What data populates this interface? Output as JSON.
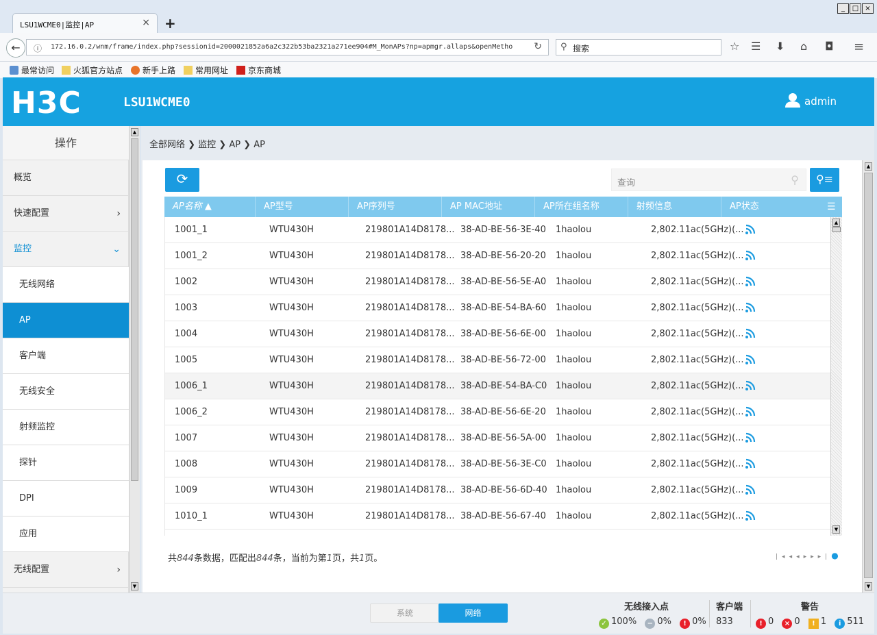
{
  "browser": {
    "tab_title": "LSU1WCME0|监控|AP",
    "tab_close": "×",
    "new_tab": "+",
    "url": "172.16.0.2/wnm/frame/index.php?sessionid=2000021852a6a2c322b53ba2321a271ee904#M_MonAPs?np=apmgr.allaps&openMetho",
    "search_placeholder": "搜索",
    "bookmarks": [
      "最常访问",
      "火狐官方站点",
      "新手上路",
      "常用网址",
      "京东商城"
    ],
    "window_controls": [
      "_",
      "□",
      "×"
    ]
  },
  "header": {
    "logo": "H3C",
    "device_name": "LSU1WCME0",
    "user": "admin"
  },
  "sidebar": {
    "title": "操作",
    "items": [
      {
        "label": "概览",
        "chevron": ""
      },
      {
        "label": "快速配置",
        "chevron": "›"
      },
      {
        "label": "监控",
        "chevron": "⌄"
      },
      {
        "label": "无线网络",
        "chevron": ""
      },
      {
        "label": "AP",
        "chevron": ""
      },
      {
        "label": "客户端",
        "chevron": ""
      },
      {
        "label": "无线安全",
        "chevron": ""
      },
      {
        "label": "射频监控",
        "chevron": ""
      },
      {
        "label": "探针",
        "chevron": ""
      },
      {
        "label": "DPI",
        "chevron": ""
      },
      {
        "label": "应用",
        "chevron": ""
      },
      {
        "label": "无线配置",
        "chevron": "›"
      }
    ]
  },
  "breadcrumb": "全部网络 ❯ 监控 ❯ AP ❯ AP",
  "toolbar": {
    "query_placeholder": "查询"
  },
  "table": {
    "columns": [
      "AP名称 ▲",
      "AP型号",
      "AP序列号",
      "AP MAC地址",
      "AP所在组名称",
      "射频信息",
      "AP状态"
    ],
    "rows": [
      [
        "1001_1",
        "WTU430H",
        "219801A14D8178...",
        "38-AD-BE-56-3E-40",
        "1haolou",
        "2,802.11ac(5GHz)(..."
      ],
      [
        "1001_2",
        "WTU430H",
        "219801A14D8178...",
        "38-AD-BE-56-20-20",
        "1haolou",
        "2,802.11ac(5GHz)(..."
      ],
      [
        "1002",
        "WTU430H",
        "219801A14D8178...",
        "38-AD-BE-56-5E-A0",
        "1haolou",
        "2,802.11ac(5GHz)(..."
      ],
      [
        "1003",
        "WTU430H",
        "219801A14D8178...",
        "38-AD-BE-54-BA-60",
        "1haolou",
        "2,802.11ac(5GHz)(..."
      ],
      [
        "1004",
        "WTU430H",
        "219801A14D8178...",
        "38-AD-BE-56-6E-00",
        "1haolou",
        "2,802.11ac(5GHz)(..."
      ],
      [
        "1005",
        "WTU430H",
        "219801A14D8178...",
        "38-AD-BE-56-72-00",
        "1haolou",
        "2,802.11ac(5GHz)(..."
      ],
      [
        "1006_1",
        "WTU430H",
        "219801A14D8178...",
        "38-AD-BE-54-BA-C0",
        "1haolou",
        "2,802.11ac(5GHz)(..."
      ],
      [
        "1006_2",
        "WTU430H",
        "219801A14D8178...",
        "38-AD-BE-56-6E-20",
        "1haolou",
        "2,802.11ac(5GHz)(..."
      ],
      [
        "1007",
        "WTU430H",
        "219801A14D8178...",
        "38-AD-BE-56-5A-00",
        "1haolou",
        "2,802.11ac(5GHz)(..."
      ],
      [
        "1008",
        "WTU430H",
        "219801A14D8178...",
        "38-AD-BE-56-3E-C0",
        "1haolou",
        "2,802.11ac(5GHz)(..."
      ],
      [
        "1009",
        "WTU430H",
        "219801A14D8178...",
        "38-AD-BE-56-6D-40",
        "1haolou",
        "2,802.11ac(5GHz)(..."
      ],
      [
        "1010_1",
        "WTU430H",
        "219801A14D8178...",
        "38-AD-BE-56-67-40",
        "1haolou",
        "2,802.11ac(5GHz)(..."
      ]
    ],
    "status_icon": "wifi-signal-icon"
  },
  "footer": {
    "prefix": "共",
    "total": "844",
    "mid1": "条数据，匹配出",
    "matched": "844",
    "mid2": "条，当前为第",
    "page": "1",
    "mid3": "页，共",
    "pages": "1",
    "suffix": "页。"
  },
  "status": {
    "toggle_system": "系统",
    "toggle_network": "网络",
    "ap_heading": "无线接入点",
    "ap_online": "100%",
    "ap_idle": "0%",
    "ap_fault": "0%",
    "client_heading": "客户端",
    "client_count": "833",
    "alarm_heading": "警告",
    "alarm_critical": "0",
    "alarm_major": "0",
    "alarm_warning": "1",
    "alarm_info": "511"
  },
  "colors": {
    "accent": "#16a2e0",
    "table_header": "#7fc9ee"
  }
}
